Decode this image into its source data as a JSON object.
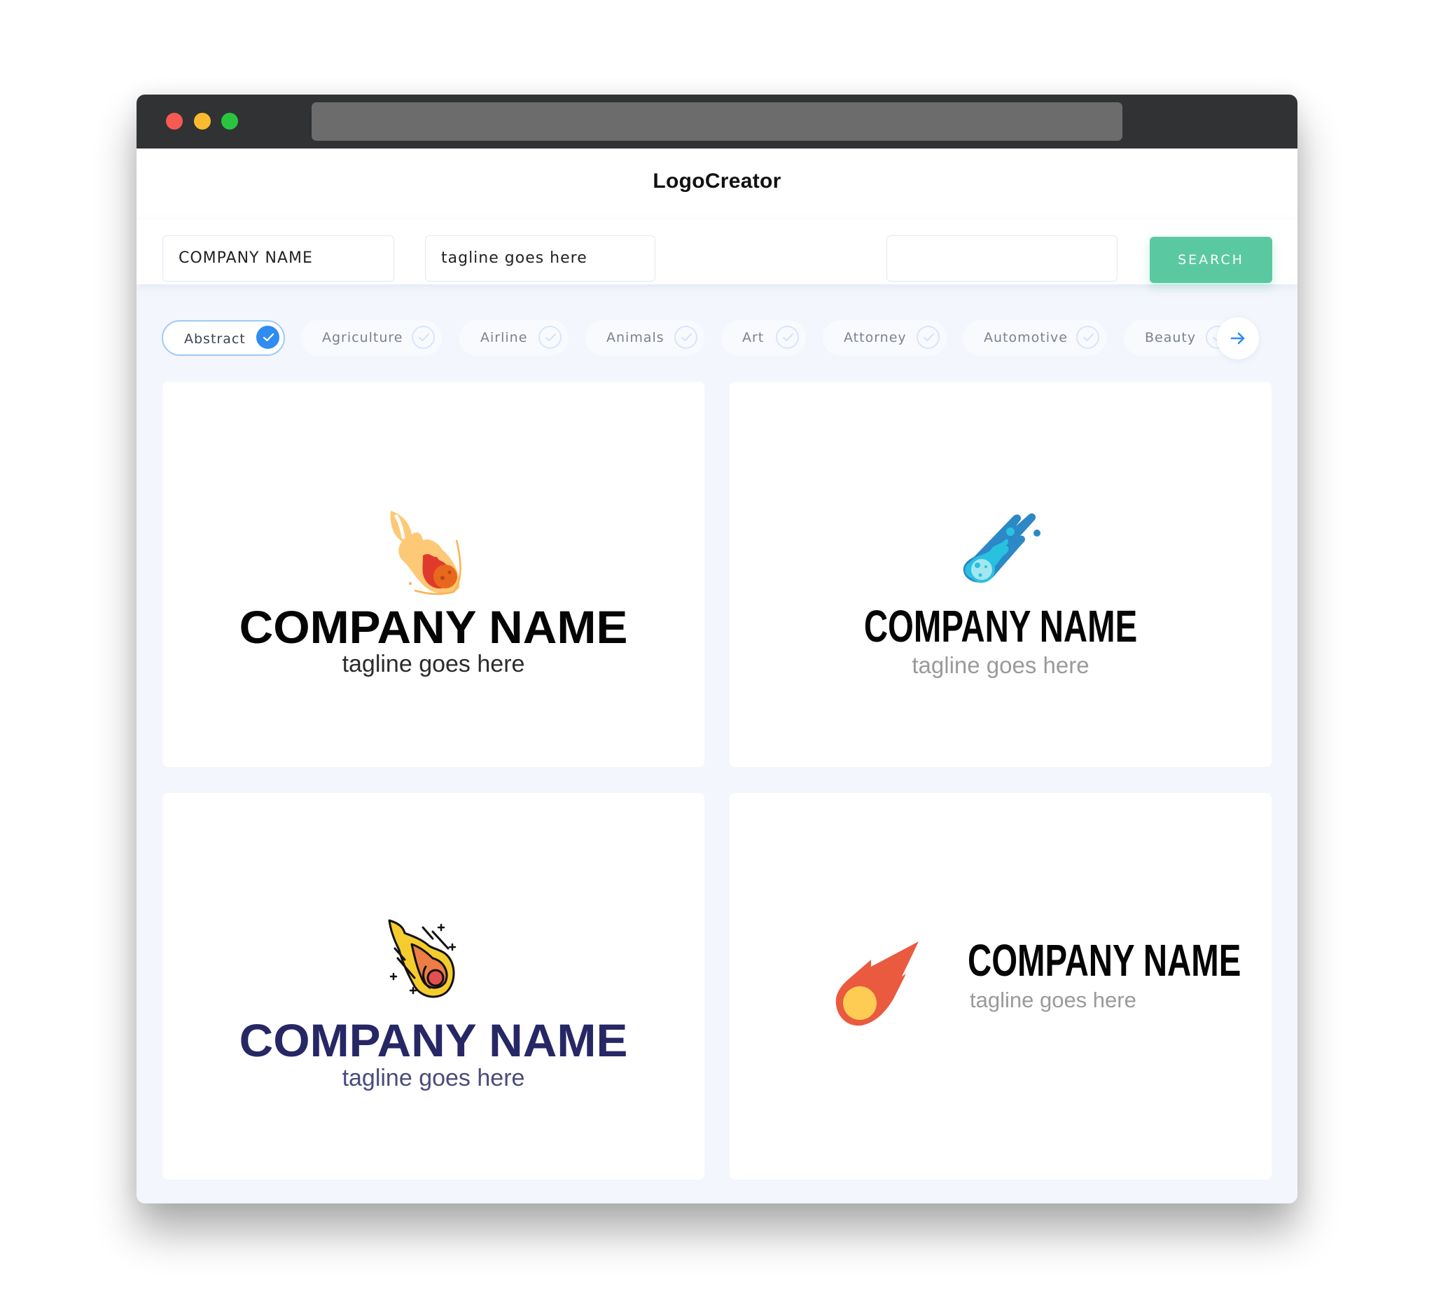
{
  "app": {
    "title": "LogoCreator"
  },
  "search": {
    "company_value": "COMPANY NAME",
    "tagline_value": "tagline goes here",
    "keyword_value": "",
    "button_label": "SEARCH"
  },
  "categories": [
    {
      "label": "Abstract",
      "selected": true
    },
    {
      "label": "Agriculture",
      "selected": false
    },
    {
      "label": "Airline",
      "selected": false
    },
    {
      "label": "Animals",
      "selected": false
    },
    {
      "label": "Art",
      "selected": false
    },
    {
      "label": "Attorney",
      "selected": false
    },
    {
      "label": "Automotive",
      "selected": false
    },
    {
      "label": "Beauty",
      "selected": false
    }
  ],
  "next_icon": "arrow-right-icon",
  "logos": [
    {
      "icon": "flaming-meteor-icon",
      "company": "COMPANY NAME",
      "tagline": "tagline goes here",
      "name_color": "#050505"
    },
    {
      "icon": "blue-comet-icon",
      "company": "COMPANY NAME",
      "tagline": "tagline goes here",
      "name_color": "#050505"
    },
    {
      "icon": "outlined-meteor-icon",
      "company": "COMPANY NAME",
      "tagline": "tagline goes here",
      "name_color": "#272766"
    },
    {
      "icon": "red-comet-icon",
      "company": "COMPANY NAME",
      "tagline": "tagline goes here",
      "name_color": "#050505"
    }
  ],
  "colors": {
    "accent_green": "#5ac9a1",
    "accent_blue": "#2f8cf0",
    "titlebar": "#313234"
  }
}
